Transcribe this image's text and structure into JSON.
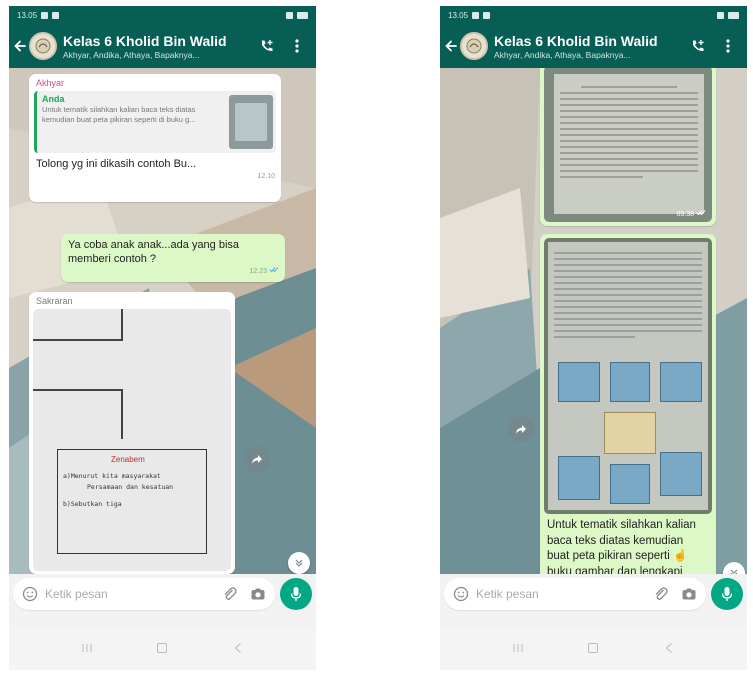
{
  "colors": {
    "header_bg": "#075e54",
    "outgoing_bubble": "#dcf8c6",
    "incoming_bubble": "#ffffff",
    "accent": "#00a884",
    "quote_bar": "#1fa855"
  },
  "left": {
    "status": {
      "time": "13.05",
      "right": ""
    },
    "header": {
      "title": "Kelas 6 Kholid Bin Walid",
      "members": "Akhyar, Andika, Athaya, Bapaknya..."
    },
    "messages": {
      "m1": {
        "sender": "Akhyar",
        "quote_author": "Anda",
        "quote_text": "Untuk tematik silahkan kalian baca teks diatas kemudian buat peta pikiran seperti di buku g...",
        "text": "Tolong yg ini dikasih contoh Bu...",
        "time": "12.10"
      },
      "m2": {
        "text": "Ya coba anak anak...ada yang bisa memberi contoh ?",
        "time": "12.23"
      },
      "m3": {
        "sender": "Sakraran",
        "photo_title": "Zenabem",
        "photo_line1": "a)Menurut kita masyarakat",
        "photo_line2": "Persamaan dan kesatuan",
        "photo_line3": "b)Sebutkan tiga"
      }
    },
    "composer": {
      "placeholder": "Ketik pesan"
    }
  },
  "right": {
    "status": {
      "time": "13.05",
      "right": ""
    },
    "header": {
      "title": "Kelas 6 Kholid Bin Walid",
      "members": "Akhyar, Andika, Athaya, Bapaknya..."
    },
    "messages": {
      "p1": {
        "time": "09.38"
      },
      "p2": {
        "caption_line1": "Untuk tematik silahkan kalian",
        "caption_line2": "baca teks diatas kemudian",
        "caption_line3": "buat peta pikiran seperti",
        "caption_line4": "buku gambar dan lengkapi"
      }
    },
    "composer": {
      "placeholder": "Ketik pesan"
    }
  },
  "icons": {
    "back": "arrow-left-icon",
    "call": "add-call-icon",
    "menu": "more-vert-icon",
    "emoji": "emoji-icon",
    "attach": "paperclip-icon",
    "camera": "camera-icon",
    "mic": "microphone-icon",
    "forward": "forward-icon",
    "scroll_down": "chevron-double-down-icon"
  }
}
